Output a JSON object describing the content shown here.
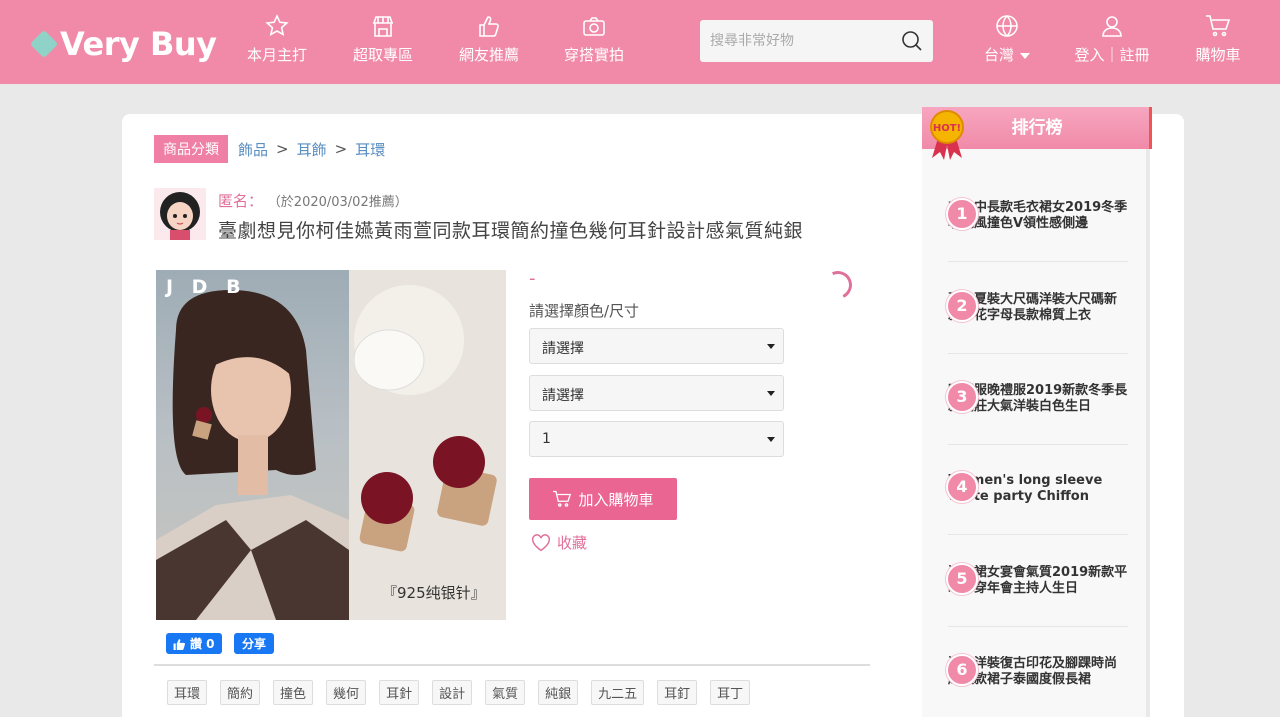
{
  "header": {
    "logo": "Very Buy",
    "nav": [
      {
        "label": "本月主打",
        "icon": "star-icon"
      },
      {
        "label": "超取專區",
        "icon": "store-icon"
      },
      {
        "label": "網友推薦",
        "icon": "thumbs-up-icon"
      },
      {
        "label": "穿搭實拍",
        "icon": "camera-icon"
      }
    ],
    "search_placeholder": "搜尋非常好物",
    "region": "台灣",
    "login": "登入｜註冊",
    "cart": "購物車"
  },
  "breadcrumb": {
    "badge": "商品分類",
    "items": [
      "飾品",
      "耳飾",
      "耳環"
    ]
  },
  "post": {
    "poster": "匿名：",
    "date": "（於2020/03/02推薦）",
    "title": "臺劇想見你柯佳嬿黃雨萱同款耳環簡約撞色幾何耳針設計感氣質純銀"
  },
  "product": {
    "image_brand": "J D B",
    "image_caption": "『925纯银针』",
    "price": "-",
    "option_label": "請選擇顏色/尺寸",
    "select1": "請選擇",
    "select2": "請選擇",
    "quantity": "1",
    "add_to_cart": "加入購物車",
    "favorite": "收藏"
  },
  "social": {
    "like": "讚 0",
    "share": "分享"
  },
  "tags": [
    "耳環",
    "簡約",
    "撞色",
    "幾何",
    "耳針",
    "設計",
    "氣質",
    "純銀",
    "九二五",
    "耳釘",
    "耳丁"
  ],
  "ranking": {
    "title": "排行榜",
    "badge": "HOT!",
    "items": [
      {
        "rank": "1",
        "text": "毛衣中長款毛衣裙女2019冬季學院風撞色V領性感側邊"
      },
      {
        "rank": "2",
        "text": "夏季夏裝大尺碼洋裝大尺碼新款印花字母長款棉質上衣"
      },
      {
        "rank": "3",
        "text": "晚禮服晚禮服2019新款冬季長款端莊大氣洋裝白色生日"
      },
      {
        "rank": "4",
        "text": "Women's long sleeve white party Chiffon"
      },
      {
        "rank": "5",
        "text": "洋裝裙女宴會氣質2019新款平時可穿年會主持人生日"
      },
      {
        "rank": "6",
        "text": "洋裝洋裝復古印花及腳踝時尚超長款裙子泰國度假長裙"
      }
    ]
  }
}
